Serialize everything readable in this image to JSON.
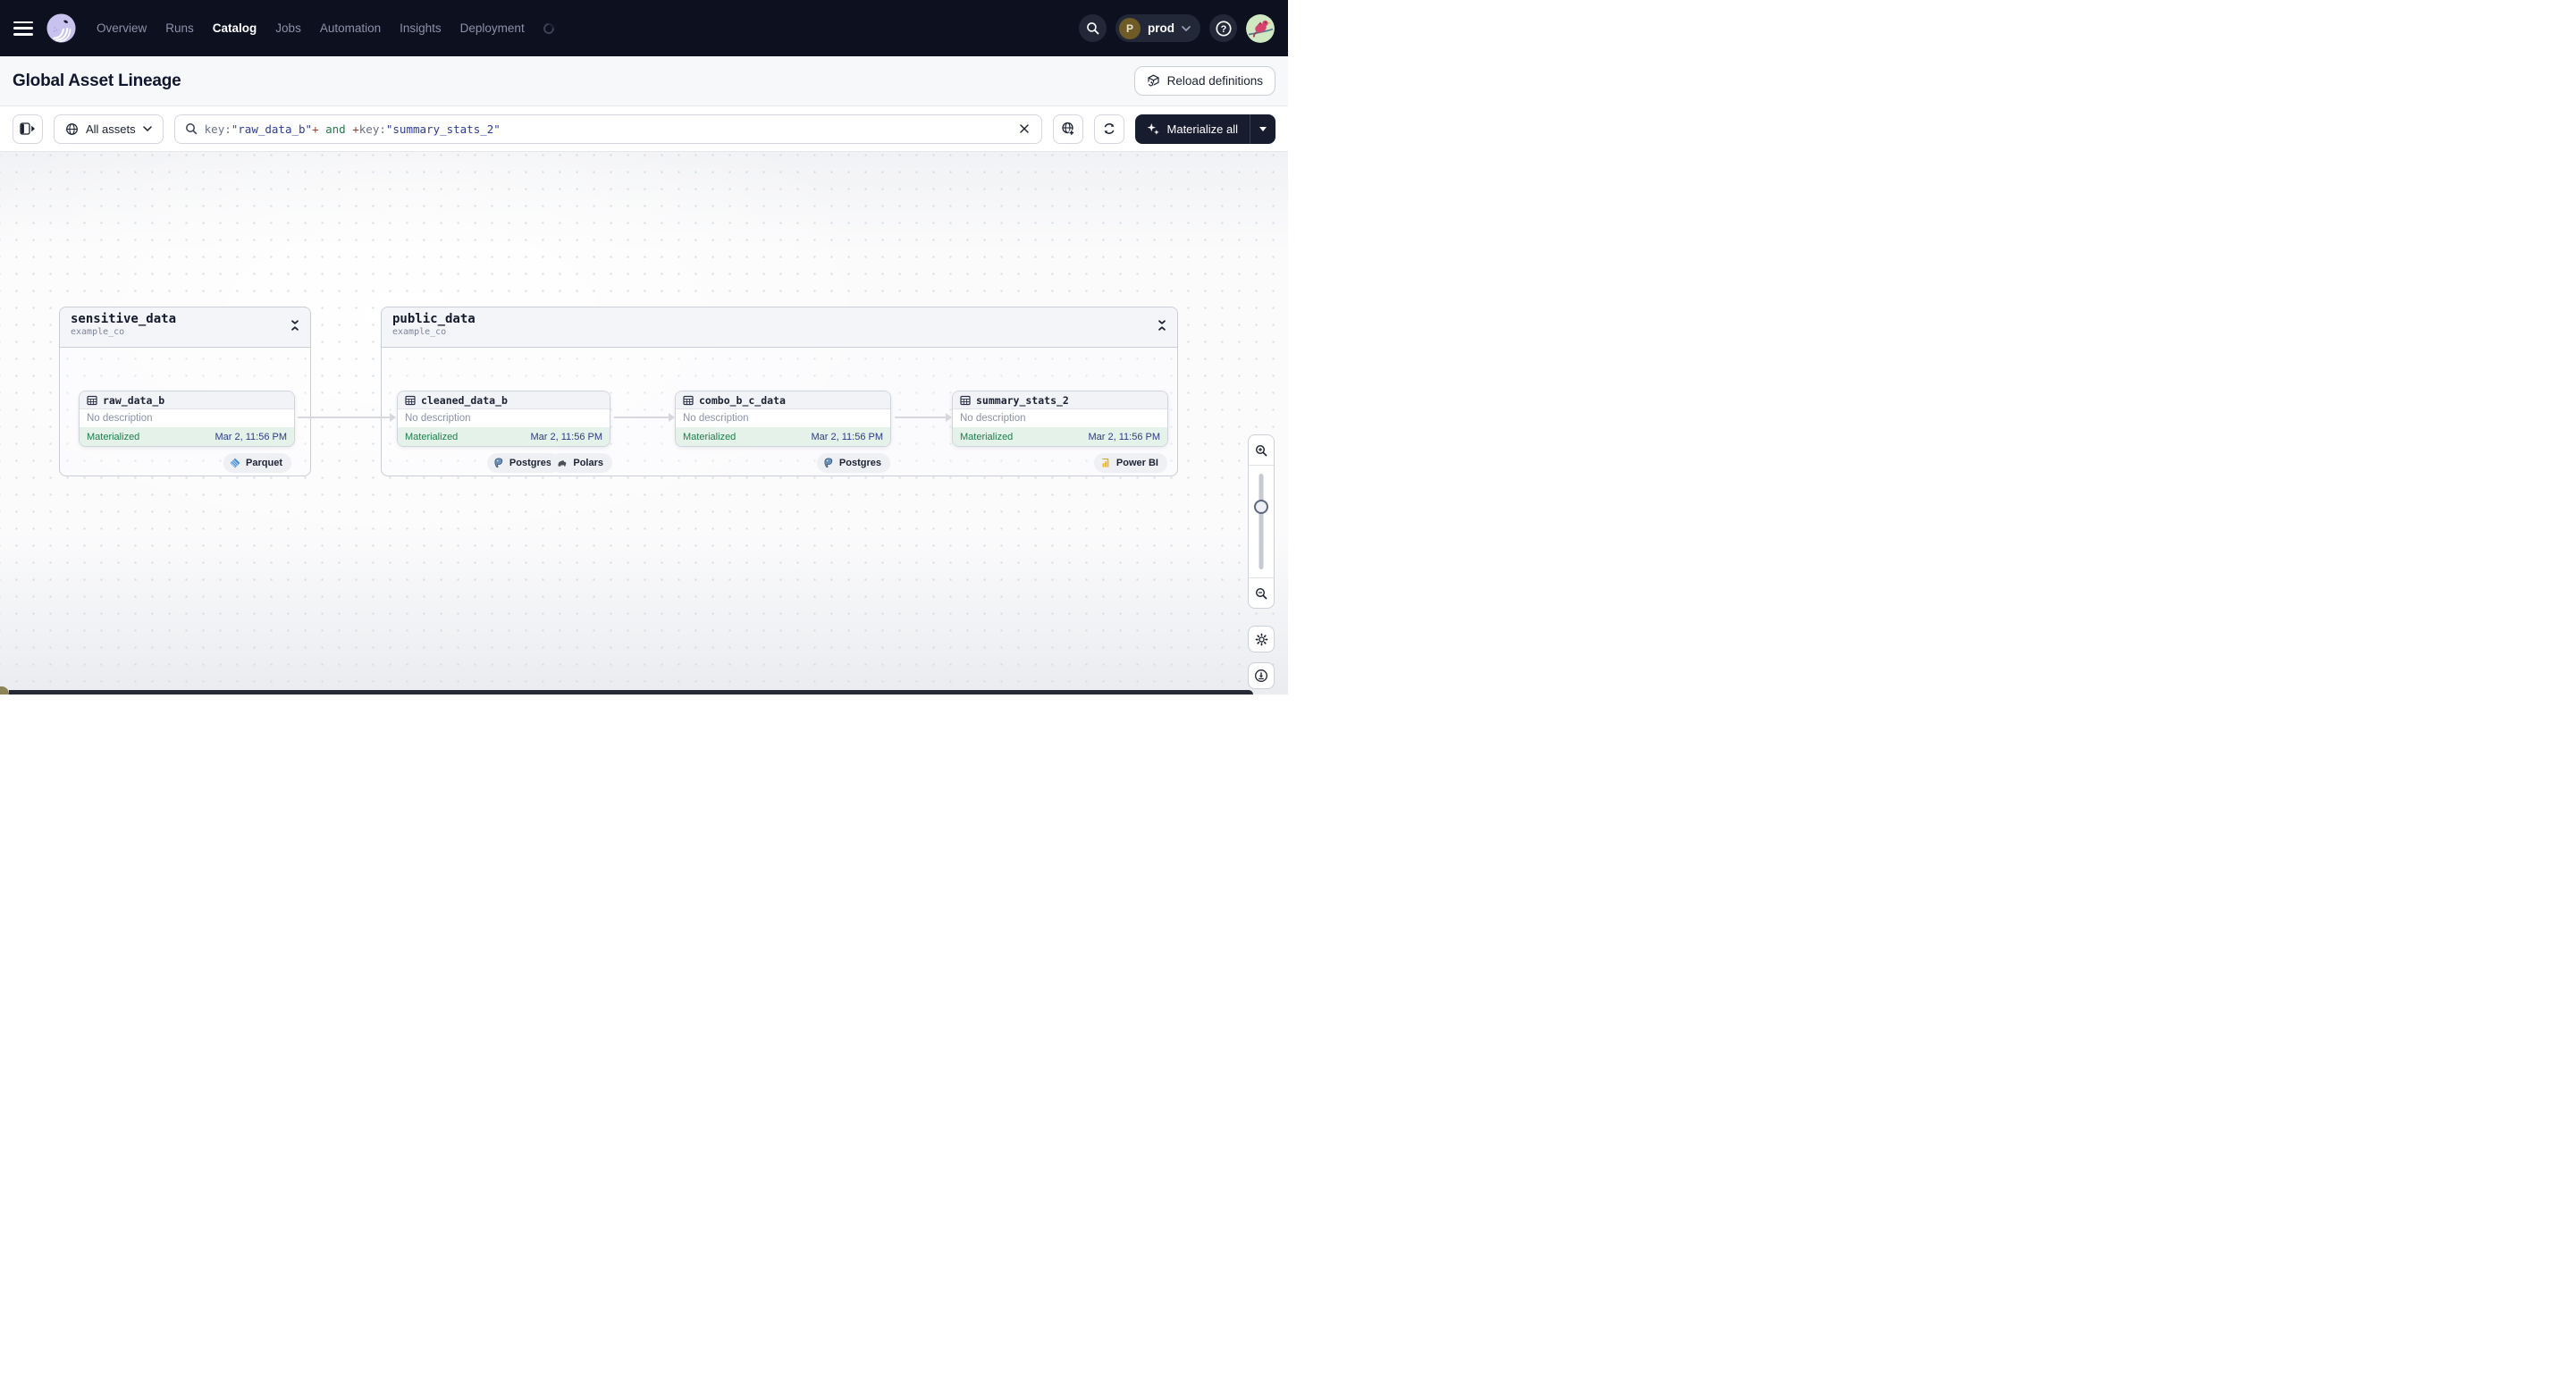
{
  "colors": {
    "nav-bg": "#0c101f",
    "accent-dark": "#171c2f",
    "status-green-text": "#1e7e4d",
    "status-green-bg": "#e4f2e9",
    "timestamp-indigo": "#2c3a8a",
    "query-key": "#6a7186",
    "query-string": "#2d3a9e",
    "query-plus": "#9c3c2e",
    "query-and": "#1f7d4c"
  },
  "nav": {
    "items": [
      {
        "label": "Overview"
      },
      {
        "label": "Runs"
      },
      {
        "label": "Catalog"
      },
      {
        "label": "Jobs"
      },
      {
        "label": "Automation"
      },
      {
        "label": "Insights"
      },
      {
        "label": "Deployment"
      }
    ],
    "active_item": "Catalog",
    "environment": {
      "initial": "P",
      "name": "prod"
    },
    "help_glyph": "?"
  },
  "header": {
    "title": "Global Asset Lineage",
    "reload_button_label": "Reload definitions"
  },
  "toolbar": {
    "scope_label": "All assets",
    "query": {
      "p1": "key:",
      "p2": "\"raw_data_b\"",
      "p3": "+",
      "p4": " and ",
      "p5": "+",
      "p6": "key:",
      "p7": "\"summary_stats_2\""
    },
    "materialize_label": "Materialize all"
  },
  "groups": [
    {
      "name": "sensitive_data",
      "location": "example_co"
    },
    {
      "name": "public_data",
      "location": "example_co"
    }
  ],
  "nodes": [
    {
      "name": "raw_data_b",
      "description": "No description",
      "status": "Materialized",
      "materialized_at": "Mar 2, 11:56 PM",
      "tags": [
        {
          "label": "Parquet",
          "icon": "parquet-icon"
        }
      ]
    },
    {
      "name": "cleaned_data_b",
      "description": "No description",
      "status": "Materialized",
      "materialized_at": "Mar 2, 11:56 PM",
      "tags": [
        {
          "label": "Postgres",
          "icon": "postgres-icon"
        },
        {
          "label": "Polars",
          "icon": "polars-icon"
        }
      ]
    },
    {
      "name": "combo_b_c_data",
      "description": "No description",
      "status": "Materialized",
      "materialized_at": "Mar 2, 11:56 PM",
      "tags": [
        {
          "label": "Postgres",
          "icon": "postgres-icon"
        }
      ]
    },
    {
      "name": "summary_stats_2",
      "description": "No description",
      "status": "Materialized",
      "materialized_at": "Mar 2, 11:56 PM",
      "tags": [
        {
          "label": "Power BI",
          "icon": "powerbi-icon"
        }
      ]
    }
  ]
}
